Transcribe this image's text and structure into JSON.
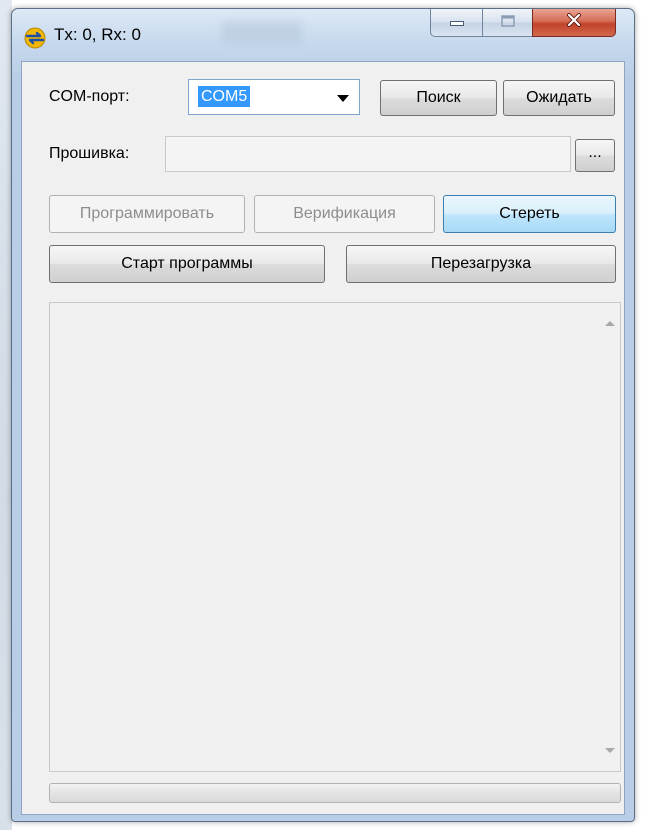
{
  "window": {
    "title": "Tx: 0, Rx: 0"
  },
  "port": {
    "label": "COM-порт:",
    "selected": "COM5",
    "search_label": "Поиск",
    "wait_label": "Ожидать"
  },
  "firmware": {
    "label": "Прошивка:",
    "value": "",
    "browse_label": "..."
  },
  "actions": {
    "program_label": "Программировать",
    "verify_label": "Верификация",
    "erase_label": "Стереть",
    "start_label": "Старт программы",
    "reboot_label": "Перезагрузка"
  },
  "log": {
    "text": ""
  },
  "progress": {
    "percent": 0
  },
  "icons": {
    "app": "app-logo-icon",
    "minimize": "minimize-icon",
    "maximize": "maximize-icon",
    "close": "close-icon",
    "dropdown": "chevron-down-icon"
  },
  "colors": {
    "selection": "#3399ff",
    "hover_button": "#bee6fd",
    "close_button": "#c2422a"
  }
}
